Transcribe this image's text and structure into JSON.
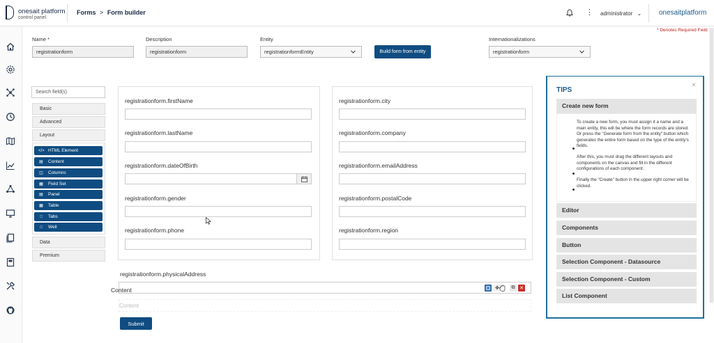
{
  "header": {
    "brand_title": "onesait platform",
    "brand_subtitle": "control panel",
    "breadcrumb_forms": "Forms",
    "breadcrumb_sep": ">",
    "breadcrumb_current": "Form builder",
    "user": "administrator",
    "user_chevron": "⌄",
    "brand_right": "onesaitplatform"
  },
  "required_note": "* Denotes Required Field",
  "form_meta": {
    "name_label": "Name *",
    "name_value": "registrationform",
    "description_label": "Description",
    "description_value": "registrationform",
    "entity_label": "Entity",
    "entity_value": "registrationformEntity",
    "build_button": "Build form from entity",
    "i18n_label": "Internationalizations",
    "i18n_value": "registrationform"
  },
  "builder": {
    "search_placeholder": "Search field(s)",
    "groups": [
      "Basic",
      "Advanced",
      "Layout",
      "Data",
      "Premium"
    ],
    "layout_components": [
      {
        "label": "HTML Element",
        "icon": "code-icon"
      },
      {
        "label": "Content",
        "icon": "html5-icon"
      },
      {
        "label": "Columns",
        "icon": "columns-icon"
      },
      {
        "label": "Field Set",
        "icon": "th-large-icon"
      },
      {
        "label": "Panel",
        "icon": "list-alt-icon"
      },
      {
        "label": "Table",
        "icon": "table-icon"
      },
      {
        "label": "Tabs",
        "icon": "folder-icon"
      },
      {
        "label": "Well",
        "icon": "square-icon"
      }
    ]
  },
  "canvas": {
    "left_fields": [
      "registrationform.firstName",
      "registrationform.lastName",
      "registrationform.dateOfBirth",
      "registrationform.gender",
      "registrationform.phone"
    ],
    "right_fields": [
      "registrationform.city",
      "registrationform.company",
      "registrationform.emailAddress",
      "registrationform.postalCode",
      "registrationform.region"
    ],
    "address_label": "registrationform.physicalAddress",
    "content_label": "Content",
    "content_ghost": "Content",
    "submit": "Submit"
  },
  "tips": {
    "title": "TIPS",
    "close": "×",
    "sections": [
      "Create new form",
      "Editor",
      "Components",
      "Button",
      "Selection Component - Datasource",
      "Selection Component - Custom",
      "List Component"
    ],
    "create_p1": "To create a new form, you must assign it a name and a main entity, this will be where the form records are stored. Or press the \"Generate form from the entity\" button which generates the entire form based on the type of the entity's fields.",
    "create_p2": "After this, you must drag the different layouts and components on the canvas and fill in the different configurations of each component.",
    "create_p3": "Finally the \"Create\" button in the upper right corner will be clicked."
  },
  "colors": {
    "primary": "#0f4c81",
    "tips_border": "#1f6e9c",
    "required": "#b22222"
  }
}
